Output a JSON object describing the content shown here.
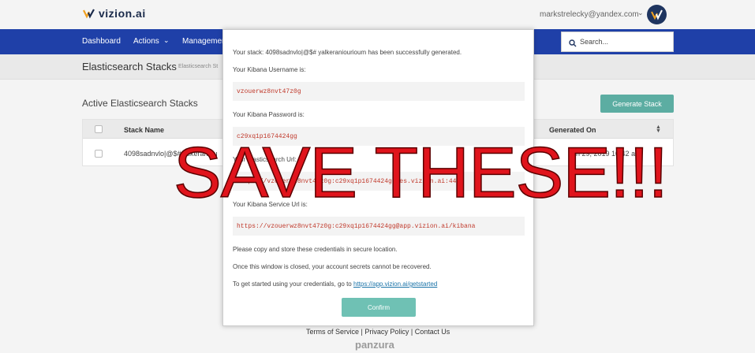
{
  "brand": {
    "logo_text": "vizion.ai",
    "colors": {
      "nav": "#1f40a8",
      "accent": "#5cada2",
      "warning": "#e0141c"
    }
  },
  "user": {
    "email": "markstrelecky@yandex.com"
  },
  "nav": {
    "items": [
      "Dashboard",
      "Actions",
      "Managemen"
    ],
    "search_placeholder": "Search..."
  },
  "breadcrumb": {
    "title": "Elasticsearch Stacks",
    "crumb": "Elasticsearch St"
  },
  "section": {
    "title": "Active Elasticsearch Stacks",
    "generate_label": "Generate Stack"
  },
  "table": {
    "columns": [
      "Stack Name",
      "Generated On"
    ],
    "rows": [
      {
        "name": "4098sadnvlo|@$#yalkeraniou",
        "generated": "an 29, 2019 10:42 am"
      }
    ]
  },
  "modal": {
    "stack_line": "Your stack: 4098sadnvlo|@$# yalkeraniourioum has been successfully generated.",
    "username_label": "Your Kibana Username is:",
    "username": "vzouerwz8nvt47z0g",
    "password_label": "Your Kibana Password is:",
    "password": "c29xq1p1674424gg",
    "es_url_label": "Your Elasticsearch Url:",
    "es_url": "https://vzouerwz8nvt47z0g:c29xq1p1674424gg@es.vizion.ai:443",
    "kibana_url_label": "Your Kibana Service Url is:",
    "kibana_url": "https://vzouerwz8nvt47z0g:c29xq1p1674424gg@app.vizion.ai/kibana",
    "note1": "Please copy and store these credentials in secure location.",
    "note2": "Once this window is closed, your account secrets cannot be recovered.",
    "note3": "To get started using your credentials, go to",
    "getstarted_link": "https://app.vizion.ai/getstarted",
    "confirm_label": "Confirm"
  },
  "overlay": {
    "text": "SAVE THESE!!!"
  },
  "footer": {
    "links": "Terms of Service | Privacy Policy | Contact Us",
    "logo": "panzura"
  }
}
